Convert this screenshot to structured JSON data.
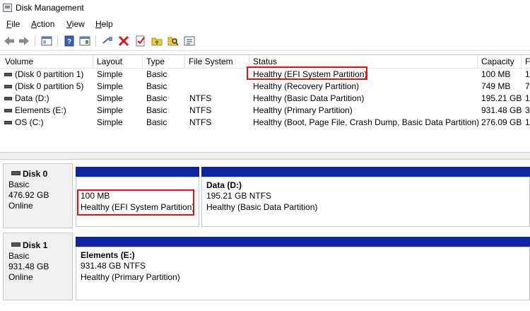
{
  "window": {
    "title": "Disk Management"
  },
  "menu": [
    {
      "label": "File"
    },
    {
      "label": "Action"
    },
    {
      "label": "View"
    },
    {
      "label": "Help"
    }
  ],
  "toolbar": {
    "buttons": [
      "back-arrow-icon",
      "forward-arrow-icon",
      "properties-pane-icon",
      "help-icon",
      "action-pane-icon",
      "connect-icon",
      "delete-icon",
      "checklist-icon",
      "folder-icon",
      "search-icon",
      "properties-icon"
    ]
  },
  "volumes": {
    "columns": [
      "Volume",
      "Layout",
      "Type",
      "File System",
      "Status",
      "Capacity",
      "F"
    ],
    "rows": [
      {
        "volume": "(Disk 0 partition 1)",
        "layout": "Simple",
        "type": "Basic",
        "fs": "",
        "status": "Healthy (EFI System Partition)",
        "capacity": "100 MB",
        "free": "1"
      },
      {
        "volume": "(Disk 0 partition 5)",
        "layout": "Simple",
        "type": "Basic",
        "fs": "",
        "status": "Healthy (Recovery Partition)",
        "capacity": "749 MB",
        "free": "7"
      },
      {
        "volume": "Data (D:)",
        "layout": "Simple",
        "type": "Basic",
        "fs": "NTFS",
        "status": "Healthy (Basic Data Partition)",
        "capacity": "195.21 GB",
        "free": "1"
      },
      {
        "volume": "Elements (E:)",
        "layout": "Simple",
        "type": "Basic",
        "fs": "NTFS",
        "status": "Healthy (Primary Partition)",
        "capacity": "931.48 GB",
        "free": "3"
      },
      {
        "volume": "OS (C:)",
        "layout": "Simple",
        "type": "Basic",
        "fs": "NTFS",
        "status": "Healthy (Boot, Page File, Crash Dump, Basic Data Partition)",
        "capacity": "276.09 GB",
        "free": "1"
      }
    ]
  },
  "disks": [
    {
      "name": "Disk 0",
      "type": "Basic",
      "size": "476.92 GB",
      "state": "Online",
      "partitions": [
        {
          "title": "",
          "size": "100 MB",
          "status": "Healthy (EFI System Partition)"
        },
        {
          "title": "Data  (D:)",
          "size": "195.21 GB NTFS",
          "status": "Healthy (Basic Data Partition)"
        }
      ]
    },
    {
      "name": "Disk 1",
      "type": "Basic",
      "size": "931.48 GB",
      "state": "Online",
      "partitions": [
        {
          "title": "Elements  (E:)",
          "size": "931.48 GB NTFS",
          "status": "Healthy (Primary Partition)"
        }
      ]
    }
  ],
  "colors": {
    "partition_header": "#0f24a3",
    "highlight": "#d9141b"
  }
}
